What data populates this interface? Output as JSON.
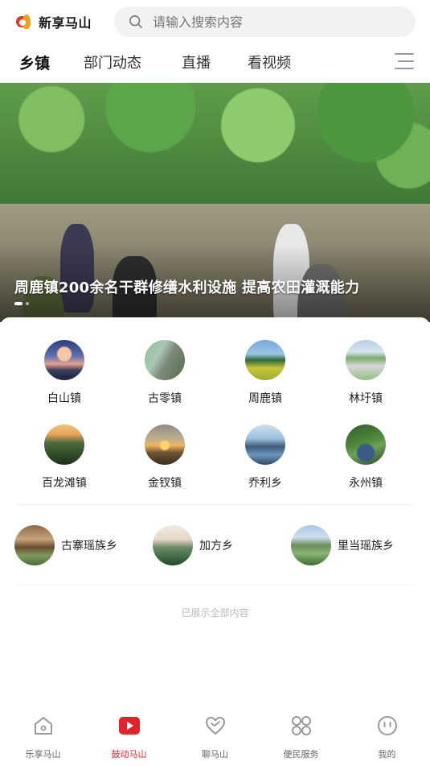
{
  "header": {
    "logo_text": "新享马山",
    "search_placeholder": "请输入搜索内容"
  },
  "tabs": [
    {
      "label": "乡镇",
      "active": true
    },
    {
      "label": "部门动态",
      "active": false
    },
    {
      "label": "直播",
      "active": false
    },
    {
      "label": "看视频",
      "active": false
    }
  ],
  "banner": {
    "title": "周鹿镇200余名干群修缮水利设施  提高农田灌溉能力",
    "slide_count": 2,
    "active_slide": 1
  },
  "towns": [
    {
      "label": "白山镇",
      "icon": "town-thumbnail"
    },
    {
      "label": "古零镇",
      "icon": "town-thumbnail"
    },
    {
      "label": "周鹿镇",
      "icon": "town-thumbnail"
    },
    {
      "label": "林圩镇",
      "icon": "town-thumbnail"
    },
    {
      "label": "百龙滩镇",
      "icon": "town-thumbnail"
    },
    {
      "label": "金钗镇",
      "icon": "town-thumbnail"
    },
    {
      "label": "乔利乡",
      "icon": "town-thumbnail"
    },
    {
      "label": "永州镇",
      "icon": "town-thumbnail"
    }
  ],
  "townships": [
    {
      "label": "古寨瑶族乡"
    },
    {
      "label": "加方乡"
    },
    {
      "label": "里当瑶族乡"
    }
  ],
  "end_note": "已展示全部内容",
  "bottom_nav": [
    {
      "label": "乐享马山",
      "icon": "home-icon",
      "active": false
    },
    {
      "label": "鼓动马山",
      "icon": "play-icon",
      "active": true
    },
    {
      "label": "聊马山",
      "icon": "heart-chat-icon",
      "active": false
    },
    {
      "label": "便民服务",
      "icon": "grid-services-icon",
      "active": false
    },
    {
      "label": "我的",
      "icon": "profile-face-icon",
      "active": false
    }
  ],
  "colors": {
    "accent": "#e3222c",
    "nav_inactive": "#888888",
    "search_bg": "#f2f2f4"
  }
}
